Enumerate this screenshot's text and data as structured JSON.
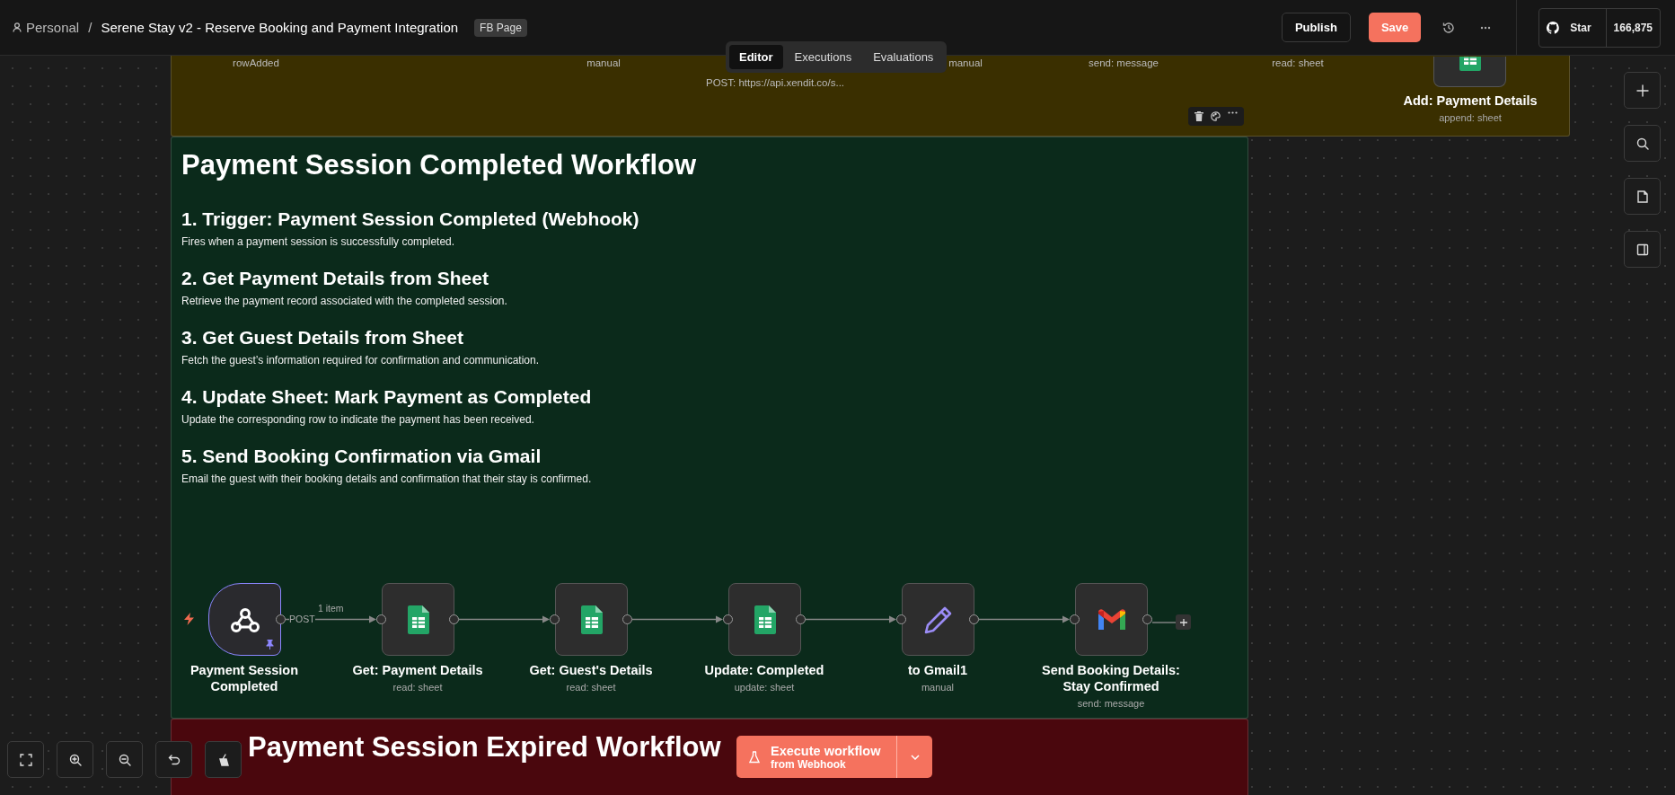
{
  "breadcrumb": {
    "owner": "Personal",
    "separator": "/",
    "workflow_name": "Serene Stay v2 - Reserve Booking and Payment Integration",
    "tag": "FB Page"
  },
  "view_tabs": [
    {
      "label": "Editor",
      "selected": true
    },
    {
      "label": "Executions",
      "selected": false
    },
    {
      "label": "Evaluations",
      "selected": false
    }
  ],
  "header_actions": {
    "publish": "Publish",
    "save": "Save"
  },
  "github": {
    "label": "Star",
    "count": "166,875"
  },
  "stickies": [
    {
      "kind": "strip",
      "color": "#3a2f00",
      "captions": [
        "rowAdded",
        "manual",
        "POST: https://api.xendit.co/s...",
        "manual",
        "send: message",
        "read: sheet"
      ],
      "node": {
        "kind": "sheets",
        "name": "Add: Payment Details",
        "subtitle": "append: sheet"
      }
    },
    {
      "kind": "notes",
      "color": "#0b2a1b",
      "title": "Payment Session Completed Workflow",
      "steps": [
        {
          "heading": "1. Trigger: Payment Session Completed (Webhook)",
          "text": "Fires when a payment session is successfully completed."
        },
        {
          "heading": "2. Get Payment Details from Sheet",
          "text": "Retrieve the payment record associated with the completed session."
        },
        {
          "heading": "3. Get Guest Details from Sheet",
          "text": "Fetch the guest’s information required for confirmation and communication."
        },
        {
          "heading": "4. Update Sheet: Mark Payment as Completed",
          "text": "Update the corresponding row to indicate the payment has been received."
        },
        {
          "heading": "5. Send Booking Confirmation via Gmail",
          "text": "Email the guest with their booking details and confirmation that their stay is confirmed."
        }
      ],
      "nodes": [
        {
          "kind": "webhook",
          "name": "Payment Session Completed",
          "pinned": true,
          "output_label": "POST",
          "item_count": "1 item"
        },
        {
          "kind": "sheets",
          "name": "Get: Payment Details",
          "subtitle": "read: sheet"
        },
        {
          "kind": "sheets",
          "name": "Get: Guest's Details",
          "subtitle": "read: sheet"
        },
        {
          "kind": "sheets",
          "name": "Update: Completed",
          "subtitle": "update: sheet"
        },
        {
          "kind": "edit",
          "name": "to Gmail1",
          "subtitle": "manual"
        },
        {
          "kind": "gmail",
          "name": "Send Booking Details: Stay Confirmed",
          "subtitle": "send: message"
        }
      ]
    },
    {
      "kind": "notes",
      "color": "#4a070d",
      "title": "Payment Session Expired Workflow"
    }
  ],
  "execute_button": {
    "label": "Execute workflow",
    "sublabel": "from Webhook"
  }
}
